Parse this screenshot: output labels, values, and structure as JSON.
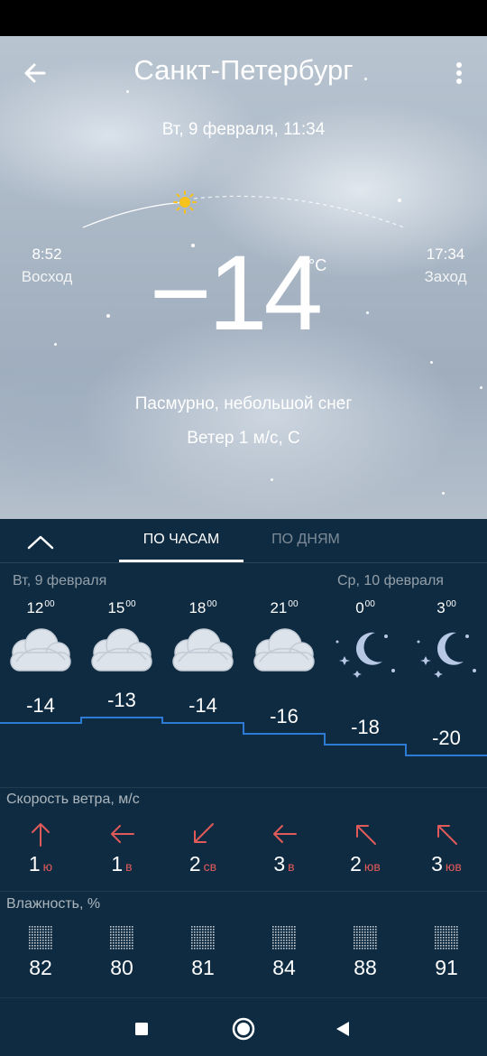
{
  "header": {
    "city": "Санкт-Петербург",
    "datetime": "Вт, 9 февраля, 11:34"
  },
  "sun": {
    "sunrise_time": "8:52",
    "sunrise_label": "Восход",
    "sunset_time": "17:34",
    "sunset_label": "Заход"
  },
  "current": {
    "temperature": "−14",
    "unit": "°C",
    "condition": "Пасмурно, небольшой снег",
    "wind": "Ветер 1 м/с, С"
  },
  "tabs": {
    "hourly": "ПО ЧАСАМ",
    "daily": "ПО ДНЯМ",
    "active": "hourly"
  },
  "days": {
    "first": "Вт, 9 февраля",
    "second": "Ср, 10 февраля"
  },
  "hours": [
    {
      "hour": "12",
      "min": "00",
      "icon": "cloud-icon",
      "temp": "-14",
      "wind_speed": "1",
      "wind_dir": "ю",
      "wind_arrow": "arrow-up-icon",
      "humidity": "82"
    },
    {
      "hour": "15",
      "min": "00",
      "icon": "cloud-icon",
      "temp": "-13",
      "wind_speed": "1",
      "wind_dir": "в",
      "wind_arrow": "arrow-left-icon",
      "humidity": "80"
    },
    {
      "hour": "18",
      "min": "00",
      "icon": "cloud-icon",
      "temp": "-14",
      "wind_speed": "2",
      "wind_dir": "св",
      "wind_arrow": "arrow-down-left-icon",
      "humidity": "81"
    },
    {
      "hour": "21",
      "min": "00",
      "icon": "cloud-icon",
      "temp": "-16",
      "wind_speed": "3",
      "wind_dir": "в",
      "wind_arrow": "arrow-left-icon",
      "humidity": "84"
    },
    {
      "hour": "0",
      "min": "00",
      "icon": "moon-stars-icon",
      "temp": "-18",
      "wind_speed": "2",
      "wind_dir": "юв",
      "wind_arrow": "arrow-up-left-icon",
      "humidity": "88"
    },
    {
      "hour": "3",
      "min": "00",
      "icon": "moon-stars-icon",
      "temp": "-20",
      "wind_speed": "3",
      "wind_dir": "юв",
      "wind_arrow": "arrow-up-left-icon",
      "humidity": "91"
    }
  ],
  "sections": {
    "wind_title": "Скорость ветра, м/с",
    "humidity_title": "Влажность, %"
  },
  "colors": {
    "panel_bg": "#0f2b41",
    "temp_line": "#2e7bd6",
    "wind_accent": "#e05a5a"
  }
}
